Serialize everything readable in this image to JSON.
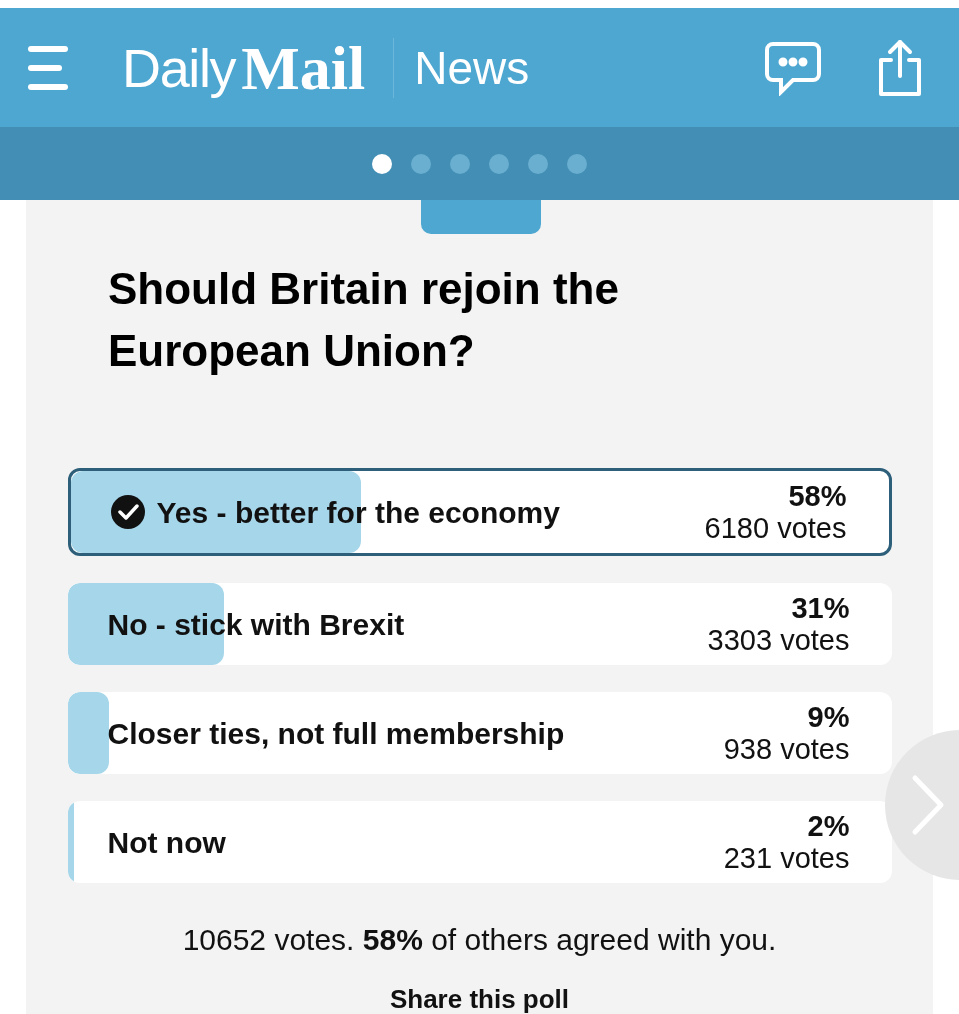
{
  "header": {
    "logo_light": "Daily",
    "logo_bold": "Mail",
    "section": "News"
  },
  "pager": [
    {
      "selected": true
    },
    {
      "selected": false
    },
    {
      "selected": false
    },
    {
      "selected": false
    },
    {
      "selected": false
    },
    {
      "selected": false
    }
  ],
  "poll": {
    "question": "Should Britain rejoin the European Union?",
    "options": [
      {
        "label": "Yes - better for the economy",
        "percent": "58%",
        "votes": "6180 votes",
        "level": 0.355,
        "selected": true
      },
      {
        "label": "No - stick with Brexit",
        "percent": "31%",
        "votes": "3303 votes",
        "level": 0.19,
        "selected": false
      },
      {
        "label": "Closer ties, not full membership",
        "percent": "9%",
        "votes": "938 votes",
        "level": 0.05,
        "selected": false
      },
      {
        "label": "Not now",
        "percent": "2%",
        "votes": "231 votes",
        "level": 0.008,
        "selected": false
      }
    ],
    "summary": "10652 votes. **58%** of others agreed with you.",
    "share": "Share this poll"
  }
}
